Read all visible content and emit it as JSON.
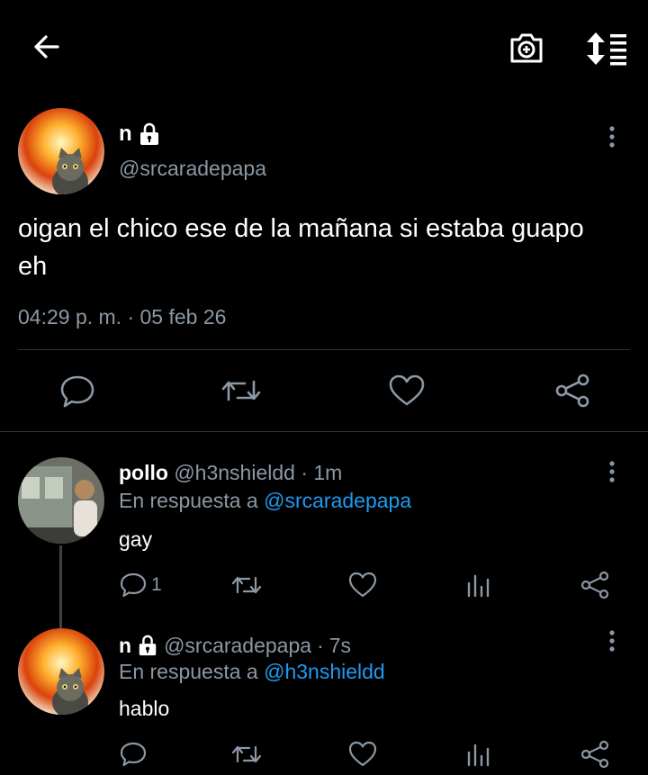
{
  "topbar": {
    "back_icon": "arrow-left-icon",
    "camera_icon": "camera-plus-icon",
    "sort_icon": "sort-list-icon"
  },
  "main_tweet": {
    "display_name": "n",
    "handle": "@srcaradepapa",
    "text": "oigan el chico ese de la mañana si estaba guapo eh",
    "timestamp": "04:29 p. m. · 05 feb 26"
  },
  "replies": [
    {
      "display_name": "pollo",
      "handle": "@h3nshieldd",
      "age": "1m",
      "reply_to_prefix": "En respuesta a",
      "reply_to": "@srcaradepapa",
      "text": "gay",
      "reply_count": "1"
    },
    {
      "display_name": "n",
      "handle": "@srcaradepapa",
      "age": "7s",
      "reply_to_prefix": "En respuesta a",
      "reply_to": "@h3nshieldd",
      "text": "hablo",
      "reply_count": ""
    }
  ],
  "colors": {
    "background": "#000000",
    "text": "#e7e9ea",
    "muted": "#8b98a5",
    "link": "#1d9bf0",
    "divider": "#2f3336"
  }
}
